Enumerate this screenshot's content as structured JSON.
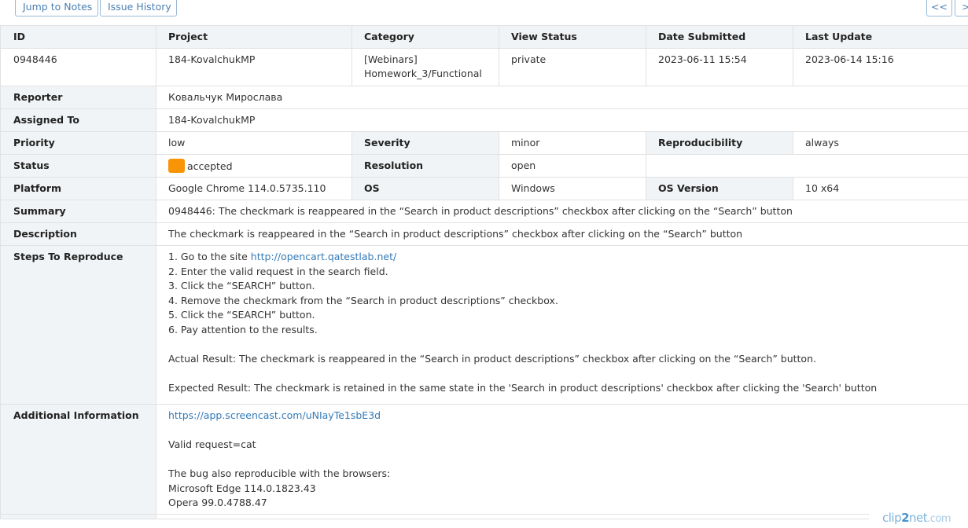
{
  "toolbar": {
    "jump_to_notes": "Jump to Notes",
    "issue_history": "Issue History",
    "prev": "<<",
    "next": ">>"
  },
  "header": {
    "id": "ID",
    "project": "Project",
    "category": "Category",
    "view_status": "View Status",
    "date_submitted": "Date Submitted",
    "last_update": "Last Update"
  },
  "issue": {
    "id": "0948446",
    "project": "184-KovalchukMP",
    "category_line1": "[Webinars]",
    "category_line2": "Homework_3/Functional",
    "view_status": "private",
    "date_submitted": "2023-06-11 15:54",
    "last_update": "2023-06-14 15:16"
  },
  "labels": {
    "reporter": "Reporter",
    "assigned_to": "Assigned To",
    "priority": "Priority",
    "severity": "Severity",
    "reproducibility": "Reproducibility",
    "status": "Status",
    "resolution": "Resolution",
    "platform": "Platform",
    "os": "OS",
    "os_version": "OS Version",
    "summary": "Summary",
    "description": "Description",
    "steps": "Steps To Reproduce",
    "additional": "Additional Information"
  },
  "values": {
    "reporter": "Ковальчук Мирослава",
    "assigned_to": "184-KovalchukMP",
    "priority": "low",
    "severity": "minor",
    "reproducibility": "always",
    "status": "accepted",
    "status_color": "#f89406",
    "resolution": "open",
    "platform": "Google Chrome 114.0.5735.110",
    "os": "Windows",
    "os_version": "10 x64",
    "summary": "0948446: The checkmark is reappeared in the “Search in product descriptions” checkbox after clicking on the “Search” button",
    "description": "The checkmark is reappeared in the “Search in product descriptions” checkbox after clicking on the “Search” button"
  },
  "steps": {
    "step1_prefix": "1. Go to the site ",
    "step1_link": "http://opencart.qatestlab.net/",
    "step2": "2. Enter the valid request in the search field.",
    "step3": "3. Click the “SEARCH” button.",
    "step4": "4. Remove the checkmark from the “Search in product descriptions” checkbox.",
    "step5": "5. Click the “SEARCH” button.",
    "step6": "6. Pay attention to the results.",
    "actual": "Actual Result: The checkmark is reappeared in the “Search in product descriptions” checkbox after clicking on the “Search” button.",
    "expected": "Expected Result: The checkmark is retained in the same state in the 'Search in product descriptions' checkbox after clicking the 'Search' button"
  },
  "additional": {
    "link": "https://app.screencast.com/uNIayTe1sbE3d",
    "valid_request": "Valid request=cat",
    "browsers_intro": "The bug also reproducible with the browsers:",
    "browser1": "Microsoft Edge 114.0.1823.43",
    "browser2": "Opera 99.0.4788.47"
  },
  "watermark": {
    "brand_a": "clip",
    "brand_b": "2",
    "brand_c": "net",
    "domain": ".com"
  },
  "colors": {
    "link": "#337ab7",
    "label_bg": "#f1f4f6",
    "border": "#e1e1e1",
    "button_border": "#98b8d6"
  }
}
